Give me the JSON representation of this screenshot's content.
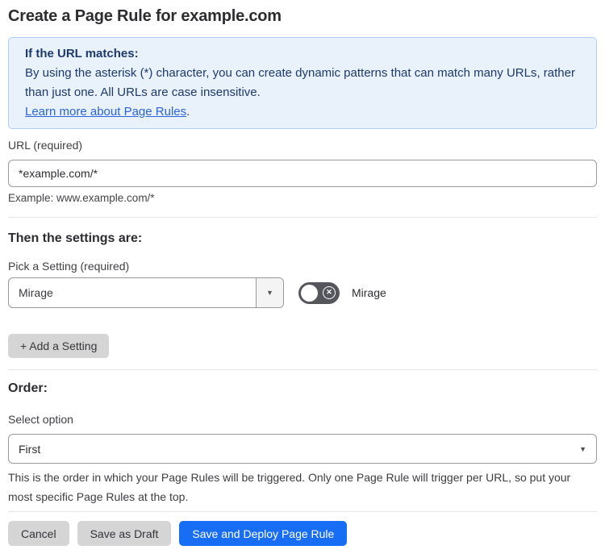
{
  "page": {
    "title": "Create a Page Rule for example.com"
  },
  "info_box": {
    "heading": "If the URL matches:",
    "body": "By using the asterisk (*) character, you can create dynamic patterns that can match many URLs, rather than just one. All URLs are case insensitive.",
    "link_label": "Learn more about Page Rules",
    "link_suffix": "."
  },
  "url_field": {
    "label": "URL (required)",
    "value": "*example.com/*",
    "helper": "Example: www.example.com/*"
  },
  "settings_section": {
    "heading": "Then the settings are:",
    "picker_label": "Pick a Setting (required)",
    "picker_value": "Mirage",
    "toggle_label": "Mirage",
    "toggle_state": "off",
    "add_setting_label": "+ Add a Setting"
  },
  "order_section": {
    "heading": "Order:",
    "select_label": "Select option",
    "select_value": "First",
    "helper": "This is the order in which your Page Rules will be triggered. Only one Page Rule will trigger per URL, so put your most specific Page Rules at the top."
  },
  "footer": {
    "cancel_label": "Cancel",
    "save_draft_label": "Save as Draft",
    "save_deploy_label": "Save and Deploy Page Rule"
  },
  "icons": {
    "dropdown_caret": "▼",
    "toggle_x": "✕"
  },
  "colors": {
    "info_bg": "#e9f1fb",
    "info_border": "#b0cdf2",
    "info_text": "#1d3a6d",
    "link_blue": "#2b64d9",
    "primary_blue": "#186df5",
    "button_gray": "#d5d5d5",
    "toggle_off_gray": "#55565c"
  }
}
